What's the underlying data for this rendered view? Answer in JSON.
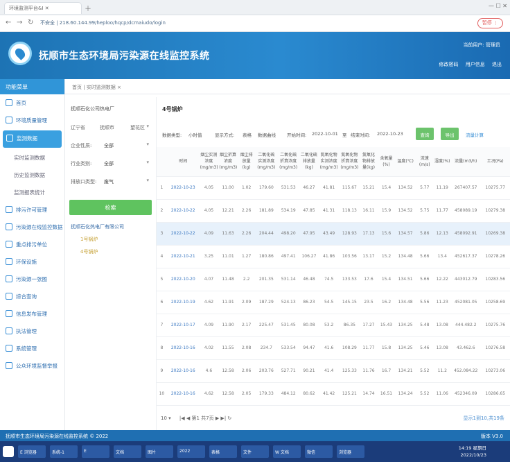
{
  "browser": {
    "tab_title": "环境监测平台&I",
    "url": "不安全 | 218.60.144.99/heploo/hqcp/dcmaiudo/login"
  },
  "app": {
    "title": "抚顺市生态环境局污染源在线监控系统",
    "user": "当前用户: 管理员",
    "links": [
      "修改密码",
      "用户信息",
      "退出"
    ]
  },
  "sidebar": {
    "header": "功能菜单",
    "items": [
      {
        "label": "首页",
        "type": "top"
      },
      {
        "label": "环境质量管理",
        "type": "top"
      },
      {
        "label": "监测数据",
        "type": "active"
      },
      {
        "label": "实时监测数据",
        "type": "sub"
      },
      {
        "label": "历史监测数据",
        "type": "sub"
      },
      {
        "label": "监测报表统计",
        "type": "sub"
      },
      {
        "label": "排污许可管理",
        "type": "top"
      },
      {
        "label": "污染源在线监控数据",
        "type": "top"
      },
      {
        "label": "重点排污单位",
        "type": "top"
      },
      {
        "label": "环保设施",
        "type": "top"
      },
      {
        "label": "污染源一张图",
        "type": "top"
      },
      {
        "label": "综合查询",
        "type": "top"
      },
      {
        "label": "信息发布管理",
        "type": "top"
      },
      {
        "label": "执法管理",
        "type": "top"
      },
      {
        "label": "系统管理",
        "type": "top"
      },
      {
        "label": "公众环境监督举报",
        "type": "top"
      }
    ]
  },
  "breadcrumb": "首页 | 实时监测数据 ×",
  "filter": {
    "company": "抚顺石化公司热电厂",
    "row1": [
      "辽宁省",
      "抚顺市",
      "望花区"
    ],
    "rows": [
      {
        "label": "企业性质:",
        "value": "全部"
      },
      {
        "label": "行业类别:",
        "value": "全部"
      },
      {
        "label": "排放口类型:",
        "value": "废气"
      }
    ],
    "query_label": "检索",
    "tree": [
      {
        "label": "抚顺石化热电厂有限公司",
        "child": false
      },
      {
        "label": "1号锅炉",
        "child": true
      },
      {
        "label": "4号锅炉",
        "child": true
      }
    ]
  },
  "content": {
    "title": "4号锅炉",
    "toolbar": {
      "type_label": "数据类型:",
      "type_value": "小时值",
      "display_label": "显示方式:",
      "display_opt1": "表格",
      "display_opt2": "数据曲线",
      "range_label": "开始时间:",
      "start": "2022-10-01",
      "to": "至",
      "end_label": "结束时间:",
      "end": "2022-10-23",
      "query": "查询",
      "export": "导出",
      "flow": "流量计算"
    },
    "columns": [
      "",
      "时间",
      "烟尘实测浓度(mg/m3)",
      "烟尘折算浓度(mg/m3)",
      "烟尘排放量(kg)",
      "二氧化硫实测浓度(mg/m3)",
      "二氧化硫折算浓度(mg/m3)",
      "二氧化硫排放量(kg)",
      "氮氧化物实测浓度(mg/m3)",
      "氮氧化物折算浓度(mg/m3)",
      "氮氧化物排放量(kg)",
      "含氧量(%)",
      "温度(℃)",
      "流速(m/s)",
      "湿度(%)",
      "流量(m3/h)",
      "工况(Pa)"
    ],
    "rows": [
      [
        "1",
        "2022-10-23",
        "4.05",
        "11.00",
        "1.02",
        "179.60",
        "531.53",
        "46.27",
        "41.81",
        "115.67",
        "15.21",
        "15.4",
        "134.52",
        "5.77",
        "11.19",
        "267407.57",
        "10275.77"
      ],
      [
        "2",
        "2022-10-22",
        "4.05",
        "12.21",
        "2.26",
        "181.89",
        "534.19",
        "47.85",
        "41.31",
        "118.13",
        "16.11",
        "15.9",
        "134.52",
        "5.75",
        "11.77",
        "458089.19",
        "10279.38"
      ],
      [
        "3",
        "2022-10-22",
        "4.09",
        "11.63",
        "2.26",
        "204.44",
        "498.20",
        "47.95",
        "43.49",
        "128.93",
        "17.13",
        "15.6",
        "134.57",
        "5.86",
        "12.13",
        "458092.91",
        "10269.38"
      ],
      [
        "4",
        "2022-10-21",
        "3.25",
        "11.01",
        "1.27",
        "180.86",
        "497.41",
        "106.27",
        "41.86",
        "103.56",
        "13.17",
        "15.2",
        "134.48",
        "5.66",
        "13.4",
        "452617.37",
        "10278.26"
      ],
      [
        "5",
        "2022-10-20",
        "4.07",
        "11.48",
        "2.2",
        "201.35",
        "531.14",
        "46.48",
        "74.5",
        "133.53",
        "17.6",
        "15.4",
        "134.51",
        "5.66",
        "12.22",
        "443012.79",
        "10283.56"
      ],
      [
        "6",
        "2022-10-19",
        "4.62",
        "11.91",
        "2.09",
        "187.29",
        "524.13",
        "86.23",
        "54.5",
        "145.15",
        "23.5",
        "16.2",
        "134.48",
        "5.56",
        "11.23",
        "452081.05",
        "10258.69"
      ],
      [
        "7",
        "2022-10-17",
        "4.09",
        "11.90",
        "2.17",
        "225.47",
        "531.45",
        "80.08",
        "53.2",
        "86.35",
        "17.27",
        "15.43",
        "134.25",
        "5.48",
        "13.08",
        "444.482.2",
        "10275.76"
      ],
      [
        "8",
        "2022-10-16",
        "4.02",
        "11.55",
        "2.08",
        "234.7",
        "533.54",
        "94.47",
        "41.6",
        "108.29",
        "11.77",
        "15.8",
        "134.25",
        "5.46",
        "13.08",
        "43.462.6",
        "10276.58"
      ],
      [
        "9",
        "2022-10-16",
        "4.6",
        "12.58",
        "2.06",
        "203.76",
        "527.71",
        "90.21",
        "41.4",
        "125.33",
        "11.76",
        "16.7",
        "134.21",
        "5.52",
        "11.2",
        "452.084.22",
        "10273.06"
      ],
      [
        "10",
        "2022-10-16",
        "4.62",
        "12.58",
        "2.05",
        "179.33",
        "484.12",
        "80.62",
        "41.42",
        "125.21",
        "14.74",
        "16.51",
        "134.24",
        "5.52",
        "11.06",
        "452346.09",
        "10286.65"
      ]
    ],
    "highlight_row": 2
  },
  "pager": {
    "size": "10 ▾",
    "nav": "|◀  ◀   第1 共7页   ▶  ▶|   ↻",
    "summary": "显示1到10,共19条"
  },
  "status": {
    "left": "抚顺市生态环境局污染源在线监控系统 © 2022",
    "right": "版本 V3.0"
  },
  "taskbar": {
    "apps": [
      "E 浏览器",
      "系统-1",
      "E",
      "文档",
      "图片",
      "2022",
      "表格",
      "文件",
      "W 文档",
      "微信",
      "浏览器"
    ],
    "time": "14:19 星期日",
    "date": "2022/10/23"
  },
  "colors": {
    "header": "#1d73b4",
    "accent": "#3095d8",
    "green": "#5fc35f",
    "highlight": "#e7f1fb"
  }
}
